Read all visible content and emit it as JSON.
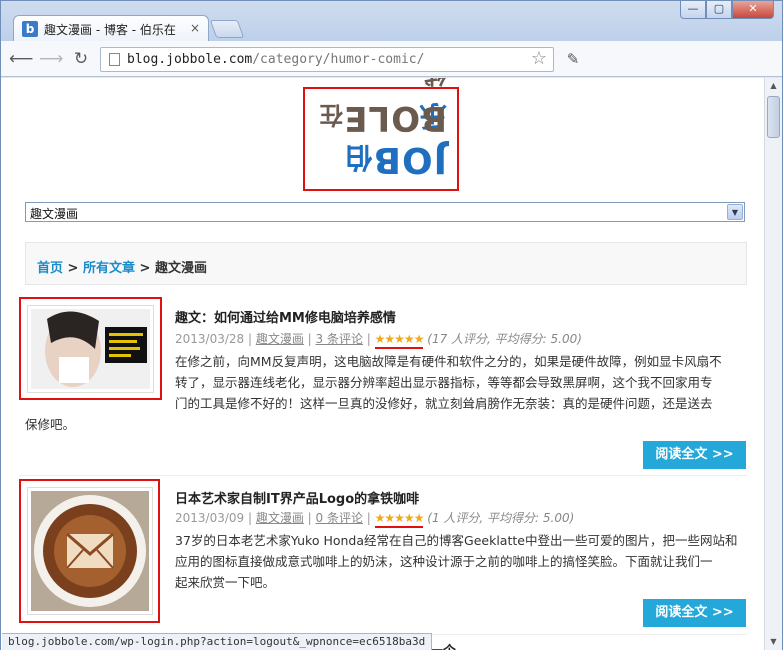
{
  "browser": {
    "tab_title": "趣文漫画 - 博客 - 伯乐在",
    "tab_close": "×",
    "favicon_letter": "b",
    "window_buttons": {
      "minimize": "—",
      "maximize": "▢",
      "close": "✕"
    },
    "url_host": "blog.jobbole.com",
    "url_path": "/category/humor-comic/",
    "status_url": "blog.jobbole.com/wp-login.php?action=logout&_wpnonce=ec6518ba3d"
  },
  "logo": {
    "en_top": "JOB",
    "cn_top": "伯乐",
    "en_bottom": "BOLE",
    "cn_bottom": "在线"
  },
  "category_select": {
    "value": "趣文漫画"
  },
  "breadcrumb": {
    "home": "首页",
    "sep1": " > ",
    "all": "所有文章",
    "sep2": " > ",
    "current": "趣文漫画"
  },
  "posts": [
    {
      "title": "趣文：如何通过给MM修电脑培养感情",
      "date": "2013/03/28",
      "category": "趣文漫画",
      "comments": "3 条评论",
      "stars": "★★★★★",
      "rating": "(17 人评分, 平均得分: 5.00)",
      "rating_count": "17",
      "rating_avg": "5.00",
      "excerpt_lines": [
        "在修之前，向MM反复声明，这电脑故障是有硬件和软件之分的，如果是硬件故障，例如显卡风扇不",
        "转了，显示器连线老化，显示器分辨率超出显示器指标，等等都会导致黑屏啊，这个我不回家用专",
        "门的工具是修不好的！这样一旦真的没修好，就立刻耸肩膀作无奈装：真的是硬件问题，还是送去",
        "保修吧。"
      ],
      "read_more": "阅读全文 >>"
    },
    {
      "title": "日本艺术家自制IT界产品Logo的拿铁咖啡",
      "date": "2013/03/09",
      "category": "趣文漫画",
      "comments": "0 条评论",
      "stars": "★★★★★",
      "rating": "(1 人评分, 平均得分: 5.00)",
      "rating_count": "1",
      "rating_avg": "5.00",
      "excerpt_lines": [
        "37岁的日本老艺术家Yuko Honda经常在自己的博客Geeklatte中登出一些可爱的图片，把一些网站和",
        "应用的图标直接做成意式咖啡上的奶沫，这种设计源于之前的咖啡上的搞怪笑脸。下面就让我们一",
        "起来欣赏一下吧。"
      ],
      "read_more": "阅读全文 >>"
    }
  ],
  "next_title_partial": "...的第一个...",
  "colors": {
    "accent": "#23a8d9",
    "highlight_red": "#e01010",
    "link": "#1a8cc8",
    "star": "#f2a818"
  }
}
